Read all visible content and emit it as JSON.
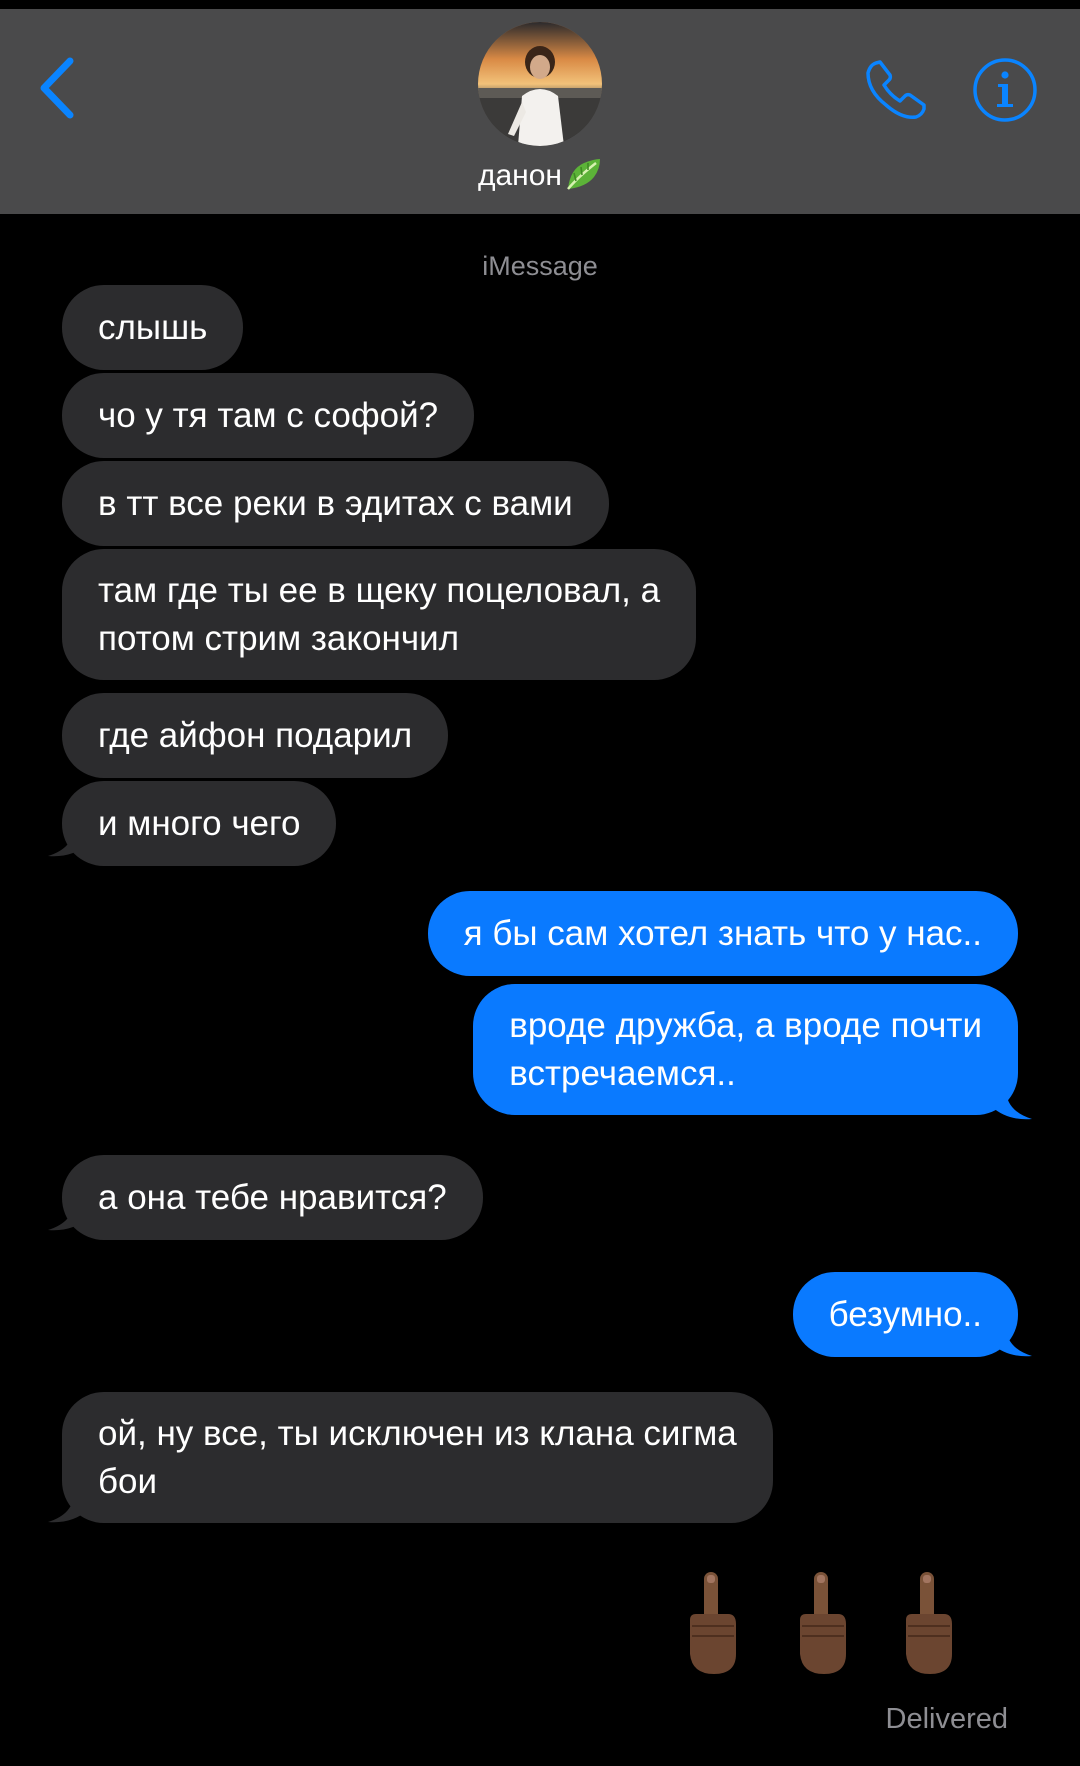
{
  "header": {
    "back_label": "Back",
    "contact_name": "данон",
    "contact_emoji_icon": "leafy-green-icon",
    "call_icon": "phone-icon",
    "info_icon": "info-icon"
  },
  "conversation": {
    "service": "iMessage",
    "messages": [
      {
        "from": "them",
        "text": "слышь"
      },
      {
        "from": "them",
        "text": "чо у тя там с софой?"
      },
      {
        "from": "them",
        "text": "в тт все реки в эдитах с вами"
      },
      {
        "from": "them",
        "text": "там где ты ее в щеку поцеловал, а\nпотом стрим закончил"
      },
      {
        "from": "them",
        "text": "где айфон подарил"
      },
      {
        "from": "them",
        "text": "и много чего"
      },
      {
        "from": "me",
        "text": "я бы сам хотел знать что у нас.."
      },
      {
        "from": "me",
        "text": "вроде дружба, а вроде почти\nвстречаемся.."
      },
      {
        "from": "them",
        "text": "а она тебе нравится?"
      },
      {
        "from": "me",
        "text": "безумно.."
      },
      {
        "from": "them",
        "text": "ой, ну все, ты исключен из клана сигма\nбои"
      },
      {
        "from": "me",
        "text": "🖕🏾🖕🏾🖕🏾"
      }
    ],
    "status": "Delivered"
  },
  "colors": {
    "background": "#000000",
    "header": "#4a4a4b",
    "incoming_bubble": "#2c2c2e",
    "outgoing_bubble": "#0a7aff",
    "accent": "#0a84ff",
    "muted_text": "#8e8e93"
  }
}
